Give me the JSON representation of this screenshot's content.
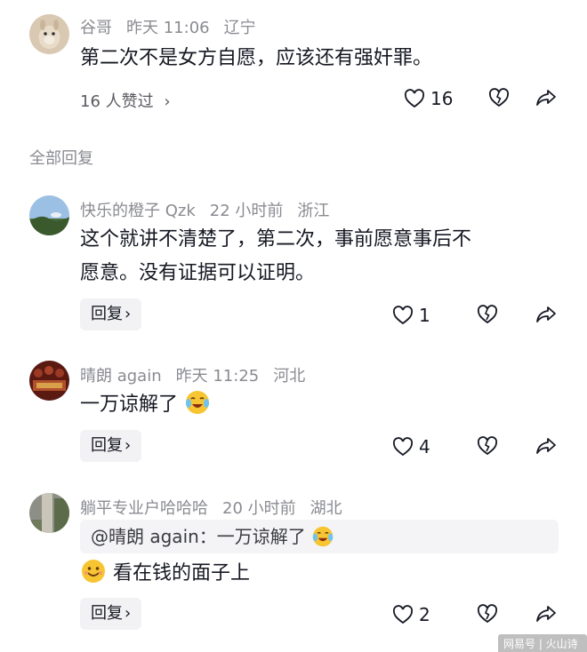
{
  "top_comment": {
    "author": "谷哥",
    "time": "昨天 11:06",
    "location": "辽宁",
    "text": "第二次不是女方自愿，应该还有强奸罪。",
    "likes_link": "16 人赞过",
    "like_count": "16"
  },
  "section_title": "全部回复",
  "replies": [
    {
      "author": "快乐的橙子 Qzk",
      "time": "22 小时前",
      "location": "浙江",
      "text_line1": "这个就讲不清楚了，第二次，事前愿意事后不",
      "text_line2": "愿意。没有证据可以证明。",
      "reply_label": "回复",
      "like_count": "1"
    },
    {
      "author": "晴朗 again",
      "time": "昨天 11:25",
      "location": "河北",
      "text": "一万谅解了",
      "reply_label": "回复",
      "like_count": "4"
    },
    {
      "author": "躺平专业户哈哈哈",
      "time": "20 小时前",
      "location": "湖北",
      "quote": "@晴朗 again：一万谅解了",
      "text": "看在钱的面子上",
      "reply_label": "回复",
      "like_count": "2"
    }
  ],
  "watermark": "网易号 | 火山诗话",
  "icons": {
    "like": "heart-outline-icon",
    "dislike": "broken-heart-icon",
    "share": "share-arrow-icon",
    "emoji_laugh_cry": "laugh-cry-emoji",
    "emoji_smile": "smile-emoji"
  }
}
